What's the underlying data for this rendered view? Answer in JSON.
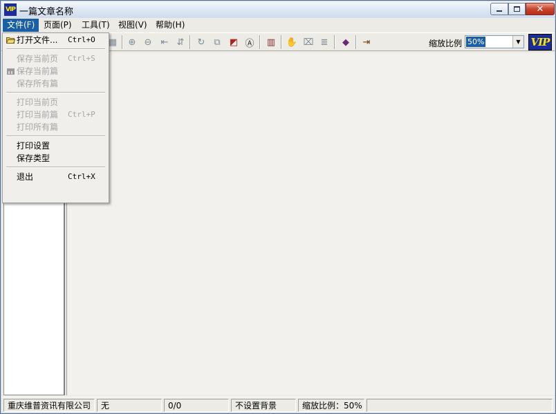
{
  "window": {
    "title": "一篇文章名称",
    "app_icon_text": "VIP"
  },
  "menubar": {
    "items": [
      {
        "label": "文件(F)"
      },
      {
        "label": "页面(P)"
      },
      {
        "label": "工具(T)"
      },
      {
        "label": "视图(V)"
      },
      {
        "label": "帮助(H)"
      }
    ]
  },
  "file_menu": {
    "items": [
      {
        "label": "打开文件...",
        "shortcut": "Ctrl+O",
        "enabled": true
      },
      {
        "label": "保存当前页",
        "shortcut": "Ctrl+S",
        "enabled": false
      },
      {
        "label": "保存当前篇",
        "shortcut": "",
        "enabled": false
      },
      {
        "label": "保存所有篇",
        "shortcut": "",
        "enabled": false
      },
      {
        "label": "打印当前页",
        "shortcut": "",
        "enabled": false
      },
      {
        "label": "打印当前篇",
        "shortcut": "Ctrl+P",
        "enabled": false
      },
      {
        "label": "打印所有篇",
        "shortcut": "",
        "enabled": false
      },
      {
        "label": "打印设置",
        "shortcut": "",
        "enabled": true
      },
      {
        "label": "保存类型",
        "shortcut": "",
        "enabled": true
      },
      {
        "label": "退出",
        "shortcut": "Ctrl+X",
        "enabled": true
      }
    ]
  },
  "toolbar": {
    "zoom_label": "缩放比例",
    "zoom_value": "50%",
    "logo_text": "VIP"
  },
  "statusbar": {
    "company": "重庆维普资讯有限公司",
    "field2": "无",
    "page_count": "0/0",
    "background": "不设置背景",
    "zoom": "缩放比例：50%"
  },
  "colors": {
    "menu_highlight": "#1a5fa6",
    "disabled_text": "#a6a6a6",
    "logo_bg": "#1b2d9a",
    "logo_fg": "#ffe800"
  }
}
